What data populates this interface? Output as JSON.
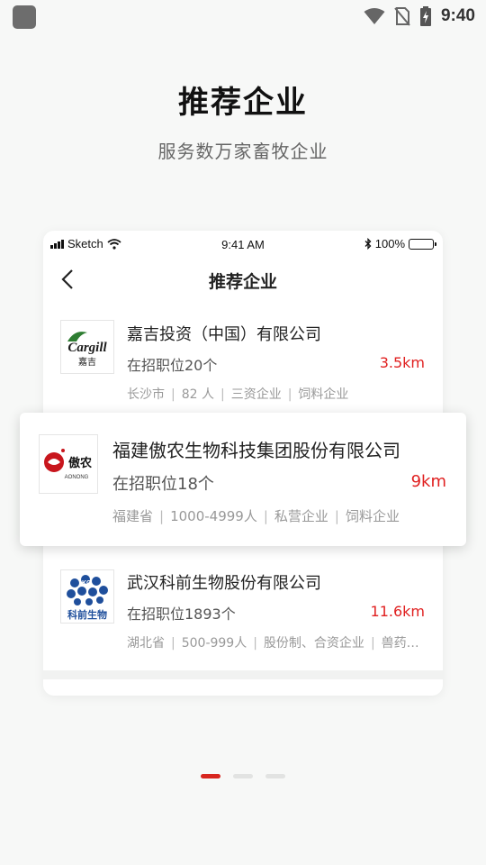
{
  "system_status": {
    "time": "9:40"
  },
  "hero": {
    "title": "推荐企业",
    "subtitle": "服务数万家畜牧企业"
  },
  "mock_phone": {
    "status": {
      "carrier": "Sketch",
      "time": "9:41 AM",
      "battery": "100%"
    },
    "nav_title": "推荐企业"
  },
  "companies": [
    {
      "name": "嘉吉投资（中国）有限公司",
      "jobs": "在招职位20个",
      "distance": "3.5km",
      "tags": [
        "长沙市",
        "82 人",
        "三资企业",
        "饲料企业"
      ],
      "logo_text": "Cargill",
      "logo_sub": "嘉吉"
    },
    {
      "name": "福建傲农生物科技集团股份有限公司",
      "jobs": "在招职位18个",
      "distance": "9km",
      "tags": [
        "福建省",
        "1000-4999人",
        "私营企业",
        "饲料企业"
      ],
      "logo_text": "傲农",
      "logo_sub": "AONONG"
    },
    {
      "name": "武汉科前生物股份有限公司",
      "jobs": "在招职位1893个",
      "distance": "11.6km",
      "tags": [
        "湖北省",
        "500-999人",
        "股份制、合资企业",
        "兽药…"
      ],
      "logo_text": "科前生物",
      "logo_sub": "KQ"
    }
  ],
  "colors": {
    "accent": "#e02020",
    "indicator_active": "#d7261f"
  },
  "pager": {
    "count": 3,
    "active_index": 0
  }
}
